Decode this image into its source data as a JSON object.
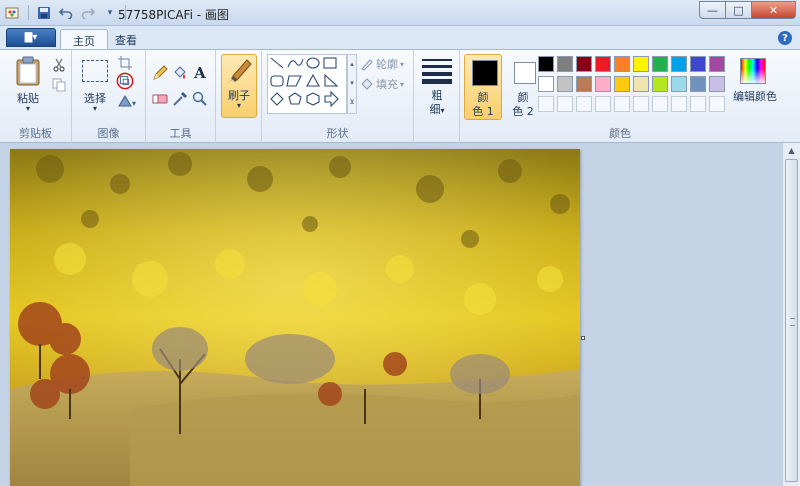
{
  "window": {
    "title": "57758PICAFi - 画图",
    "minimize": "—",
    "maximize": "□",
    "close": "✕"
  },
  "quick_access": {
    "paint_icon": "paint-app-icon",
    "save_icon": "save-icon",
    "undo_icon": "undo-icon",
    "redo_icon": "redo-icon",
    "customize_icon": "chevron-down-icon"
  },
  "tabs": {
    "app_menu": "▇▾",
    "items": [
      {
        "label": "主页",
        "active": true
      },
      {
        "label": "查看",
        "active": false
      }
    ],
    "help": "?"
  },
  "ribbon": {
    "clipboard": {
      "paste_label": "粘贴",
      "group_label": "剪贴板"
    },
    "image": {
      "select_label": "选择",
      "group_label": "图像"
    },
    "tools": {
      "group_label": "工具",
      "text_tool": "A"
    },
    "brushes": {
      "label": "刷子"
    },
    "shapes": {
      "outline_label": "轮廓",
      "fill_label": "填充",
      "group_label": "形状"
    },
    "size": {
      "label_line1": "粗",
      "label_line2": "细"
    },
    "colors": {
      "color1_line1": "颜",
      "color1_line2": "色 1",
      "color2_line1": "颜",
      "color2_line2": "色 2",
      "color1_value": "#000000",
      "color2_value": "#ffffff",
      "edit_colors_label": "编辑颜色",
      "group_label": "颜色",
      "palette_row1": [
        "#000000",
        "#7f7f7f",
        "#880015",
        "#ed1c24",
        "#ff7f27",
        "#fff200",
        "#22b14c",
        "#00a2e8",
        "#3f48cc",
        "#a349a4"
      ],
      "palette_row2": [
        "#ffffff",
        "#c3c3c3",
        "#b97a57",
        "#ffaec9",
        "#ffc90e",
        "#efe4b0",
        "#b5e61d",
        "#99d9ea",
        "#7092be",
        "#c8bfe7"
      ]
    }
  }
}
